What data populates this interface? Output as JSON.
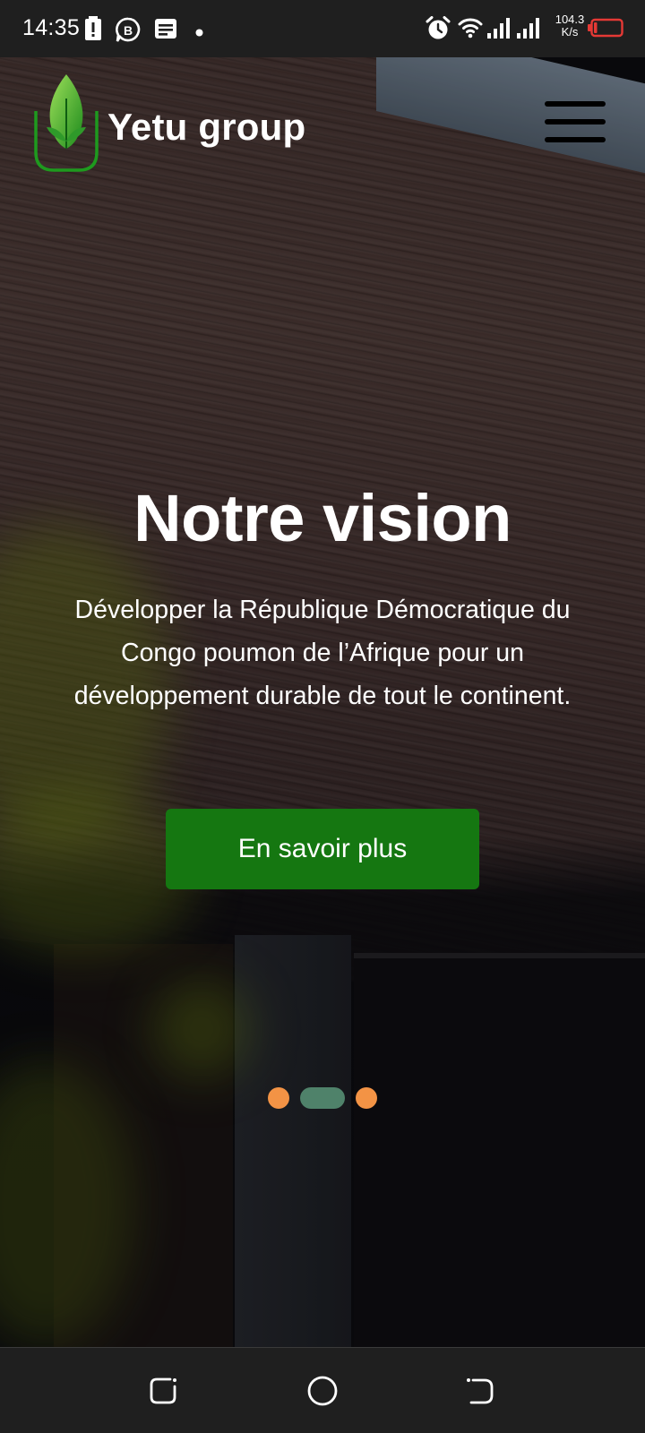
{
  "status_bar": {
    "time": "14:35",
    "net_speed_value": "104.3",
    "net_speed_unit": "K/s",
    "icons": [
      "battery-alert-icon",
      "business-chat-icon",
      "message-icon",
      "dot-icon",
      "alarm-icon",
      "wifi-icon",
      "signal-icon",
      "battery-low-icon"
    ],
    "battery_color": "#e53935"
  },
  "header": {
    "brand_name": "Yetu group",
    "logo_icon": "leaf-logo-icon",
    "menu_icon": "hamburger-menu-icon"
  },
  "hero": {
    "title": "Notre vision",
    "description": "Développer la République Démocratique du Congo poumon de l’Afrique pour un développement durable de tout le continent.",
    "cta_label": "En savoir plus",
    "cta_color": "#157711",
    "slides_total": 3,
    "active_slide": 2,
    "dot_color": "#f39345",
    "active_dot_color": "#4f826a"
  },
  "nav_bar": {
    "icons": [
      "recent-apps-icon",
      "home-icon",
      "back-icon"
    ]
  }
}
